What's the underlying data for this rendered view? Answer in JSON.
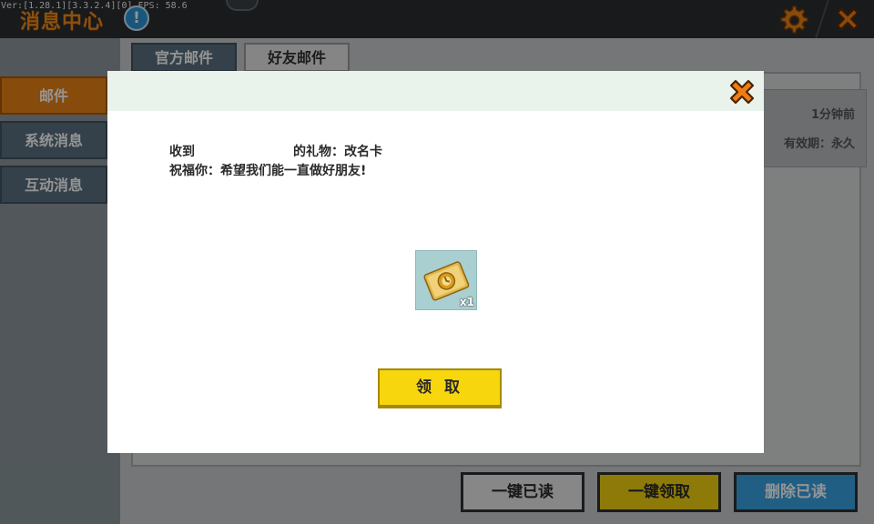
{
  "header": {
    "title": "消息中心",
    "version_info": "Ver:[1.28.1][3.3.2.4][0] FPS: 58.6",
    "alert_badge": "!"
  },
  "sidebar": {
    "items": [
      {
        "label": "邮件",
        "active": true
      },
      {
        "label": "系统消息",
        "active": false
      },
      {
        "label": "互动消息",
        "active": false
      }
    ]
  },
  "tabs": [
    {
      "label": "官方邮件",
      "active": true
    },
    {
      "label": "好友邮件",
      "active": false
    }
  ],
  "mail_card": {
    "time": "1分钟前",
    "validity": "有效期：永久"
  },
  "bottom_buttons": {
    "read_all": "一键已读",
    "claim_all": "一键领取",
    "delete_read": "删除已读"
  },
  "modal": {
    "received_prefix": "收到",
    "gift_suffix": "的礼物：改名卡",
    "blessing": "祝福你：希望我们能一直做好朋友!",
    "reward_quantity": "x1",
    "claim_button": "领 取"
  },
  "icons": {
    "settings": "gear-icon",
    "close": "close-icon",
    "reward": "rename-card-icon"
  },
  "colors": {
    "accent_orange": "#f08a1c",
    "claim_yellow": "#f7d60e",
    "delete_blue": "#3aa2e2"
  }
}
